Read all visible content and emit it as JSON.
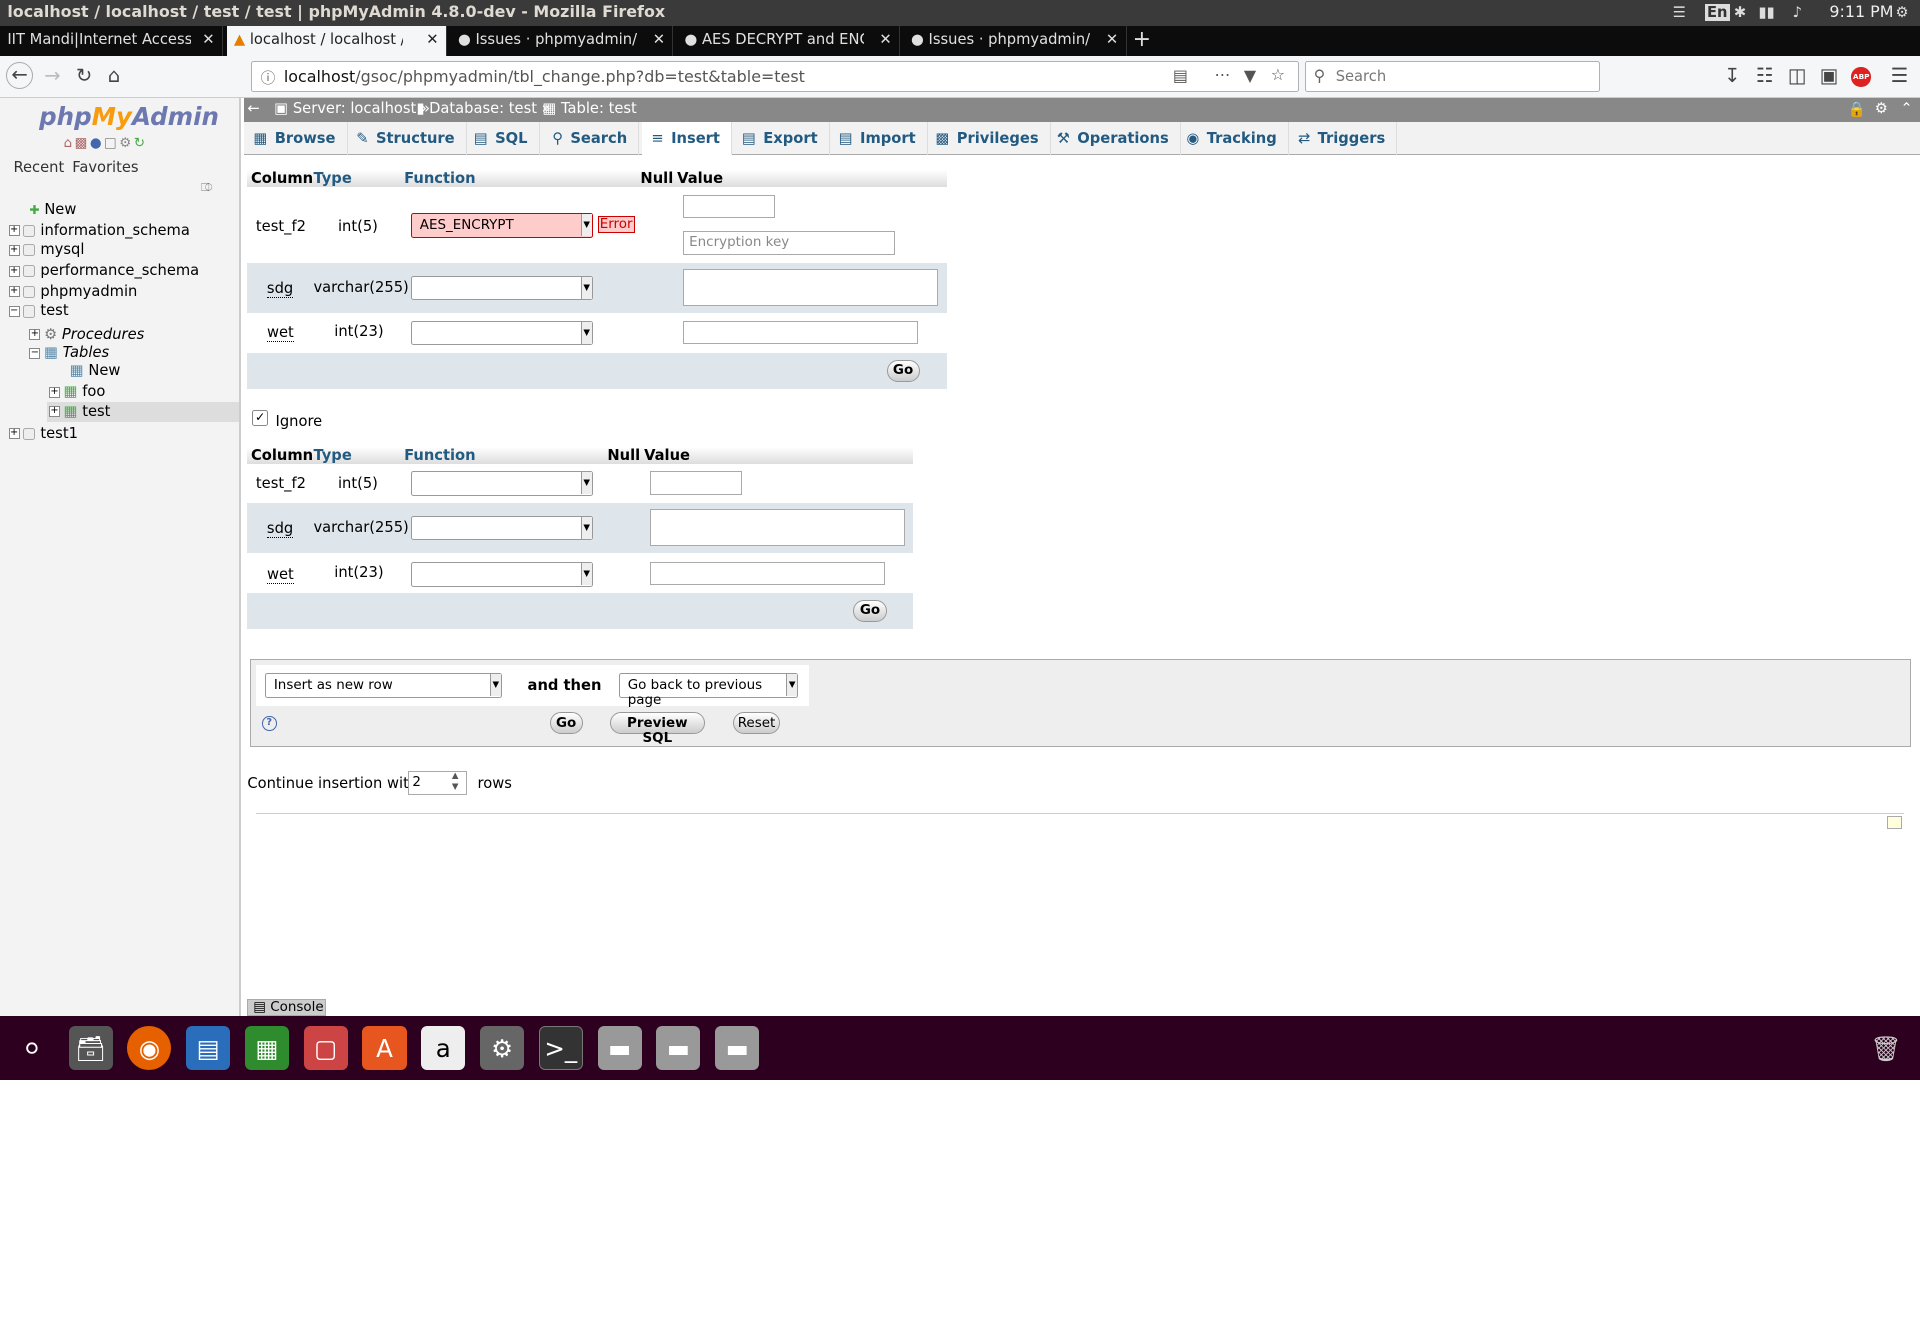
{
  "window_title": "localhost / localhost / test / test | phpMyAdmin 4.8.0-dev - Mozilla Firefox",
  "clock": "9:11 PM",
  "tray": {
    "lang": "En"
  },
  "browser_tabs": [
    {
      "label": "IIT Mandi|Internet Access"
    },
    {
      "label": "localhost / localhost / test"
    },
    {
      "label": "Issues · phpmyadmin/phpmyadmin"
    },
    {
      "label": "AES DECRYPT and ENCRYPT"
    },
    {
      "label": "Issues · phpmyadmin/phpmyadmin"
    }
  ],
  "url": {
    "host": "localhost",
    "path": "/gsoc/phpmyadmin/tbl_change.php?db=test&table=test"
  },
  "search": {
    "placeholder": "Search"
  },
  "logo": {
    "php": "php",
    "my": "My",
    "admin": "Admin"
  },
  "left_links": {
    "recent": "Recent",
    "favorites": "Favorites"
  },
  "tree": {
    "new": "New",
    "information_schema": "information_schema",
    "mysql": "mysql",
    "performance_schema": "performance_schema",
    "phpmyadmin": "phpmyadmin",
    "test": "test",
    "procedures": "Procedures",
    "tables": "Tables",
    "tables_new": "New",
    "foo": "foo",
    "test_table": "test",
    "test1": "test1"
  },
  "breadcrumb": {
    "server": "Server: localhost",
    "database": "Database: test",
    "table": "Table: test"
  },
  "main_tabs": [
    {
      "label": "Browse",
      "icon": "browse-icon"
    },
    {
      "label": "Structure",
      "icon": "structure-icon"
    },
    {
      "label": "SQL",
      "icon": "sql-icon"
    },
    {
      "label": "Search",
      "icon": "search-icon"
    },
    {
      "label": "Insert",
      "icon": "insert-icon"
    },
    {
      "label": "Export",
      "icon": "export-icon"
    },
    {
      "label": "Import",
      "icon": "import-icon"
    },
    {
      "label": "Privileges",
      "icon": "privileges-icon"
    },
    {
      "label": "Operations",
      "icon": "operations-icon"
    },
    {
      "label": "Tracking",
      "icon": "tracking-icon"
    },
    {
      "label": "Triggers",
      "icon": "triggers-icon"
    }
  ],
  "table_headers": {
    "column": "Column",
    "type": "Type",
    "function": "Function",
    "null": "Null",
    "value": "Value"
  },
  "form1": {
    "rows": [
      {
        "column": "test_f2",
        "type": "int(5)",
        "function": "AES_ENCRYPT",
        "error": "Error",
        "key_placeholder": "Encryption key"
      },
      {
        "column": "sdg",
        "type": "varchar(255)",
        "function": ""
      },
      {
        "column": "wet",
        "type": "int(23)",
        "function": ""
      }
    ],
    "go": "Go"
  },
  "ignore_label": "Ignore",
  "form2": {
    "rows": [
      {
        "column": "test_f2",
        "type": "int(5)",
        "function": ""
      },
      {
        "column": "sdg",
        "type": "varchar(255)",
        "function": ""
      },
      {
        "column": "wet",
        "type": "int(23)",
        "function": ""
      }
    ],
    "go": "Go"
  },
  "actions": {
    "insert_mode": "Insert as new row",
    "and_then": "and then",
    "after": "Go back to previous page",
    "go": "Go",
    "preview": "Preview SQL",
    "reset": "Reset"
  },
  "continue": {
    "prefix": "Continue insertion with",
    "value": "2",
    "suffix": "rows"
  },
  "console": "Console"
}
